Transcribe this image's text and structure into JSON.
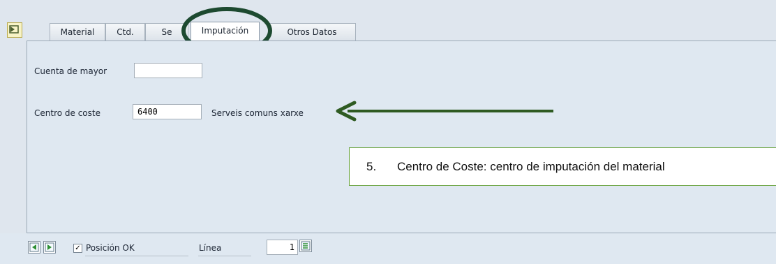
{
  "tabs": [
    {
      "label": "Material"
    },
    {
      "label": "Ctd."
    },
    {
      "label": "Se"
    },
    {
      "label": "Imputación",
      "active": true
    },
    {
      "label": "Otros Datos"
    }
  ],
  "fields": {
    "cuenta_label": "Cuenta de mayor",
    "cuenta_value": "",
    "centro_label": "Centro de coste",
    "centro_value": "6400",
    "centro_desc": "Serveis comuns xarxe"
  },
  "annotation": {
    "number": "5.",
    "text": "Centro de Coste: centro de imputación del material"
  },
  "footer": {
    "checkbox_label": "Posición OK",
    "checkbox_checked": true,
    "linea_label": "Línea",
    "linea_value": "1"
  },
  "colors": {
    "circle": "#1d4a30",
    "arrow": "#2f5b22",
    "callout_border": "#69a33c"
  },
  "icons": [
    "sidebar-toggle-icon",
    "previous-item-icon",
    "next-item-icon",
    "checkmark-icon",
    "line-select-icon"
  ]
}
